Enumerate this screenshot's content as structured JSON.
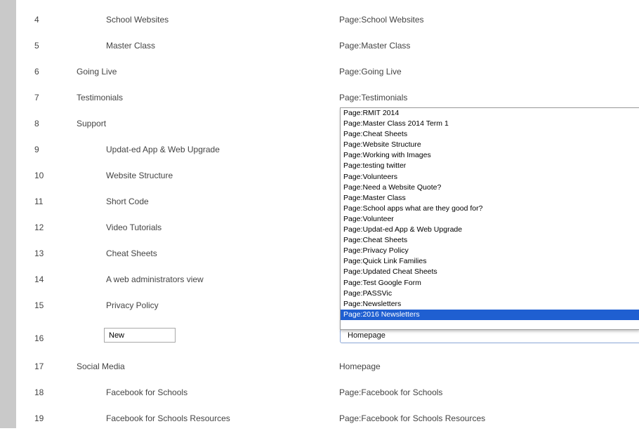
{
  "rows": [
    {
      "num": "4",
      "title": "School Websites",
      "target": "Page:School Websites"
    },
    {
      "num": "5",
      "title": "Master Class",
      "target": "Page:Master Class"
    },
    {
      "num": "6",
      "title": "Going Live",
      "target": "Page:Going Live"
    },
    {
      "num": "7",
      "title": "Testimonials",
      "target": "Page:Testimonials"
    },
    {
      "num": "8",
      "title": "Support",
      "target": ""
    },
    {
      "num": "9",
      "title": "Updat-ed App & Web Upgrade",
      "target": ""
    },
    {
      "num": "10",
      "title": "Website Structure",
      "target": ""
    },
    {
      "num": "11",
      "title": "Short Code",
      "target": ""
    },
    {
      "num": "12",
      "title": "Video Tutorials",
      "target": ""
    },
    {
      "num": "13",
      "title": "Cheat Sheets",
      "target": ""
    },
    {
      "num": "14",
      "title": "A web administrators view",
      "target": ""
    },
    {
      "num": "15",
      "title": "Privacy Policy",
      "target": ""
    },
    {
      "num": "16",
      "title": "New",
      "target": "Homepage"
    },
    {
      "num": "17",
      "title": "Social Media",
      "target": "Homepage"
    },
    {
      "num": "18",
      "title": "Facebook for Schools",
      "target": "Page:Facebook for Schools"
    },
    {
      "num": "19",
      "title": "Facebook for Schools Resources",
      "target": "Page:Facebook for Schools Resources"
    }
  ],
  "dropdown": {
    "options": [
      "Page:RMIT 2014",
      "Page:Master Class 2014 Term 1",
      "Page:Cheat Sheets",
      "Page:Website Structure",
      "Page:Working with Images",
      "Page:testing twitter",
      "Page:Volunteers",
      "Page:Need a Website Quote?",
      "Page:Master Class",
      "Page:School apps what are they good for?",
      "Page:Volunteer",
      "Page:Updat-ed App & Web Upgrade",
      "Page:Cheat Sheets",
      "Page:Privacy Policy",
      "Page:Quick Link Families",
      "Page:Updated Cheat Sheets",
      "Page:Test Google Form",
      "Page:PASSVic",
      "Page:Newsletters",
      "Page:2016 Newsletters"
    ],
    "highlighted": "Page:2016 Newsletters"
  },
  "colors": {
    "gutter": "#c9c9c9",
    "highlight": "#1f5fd1",
    "select_border": "#8aa6d6"
  }
}
